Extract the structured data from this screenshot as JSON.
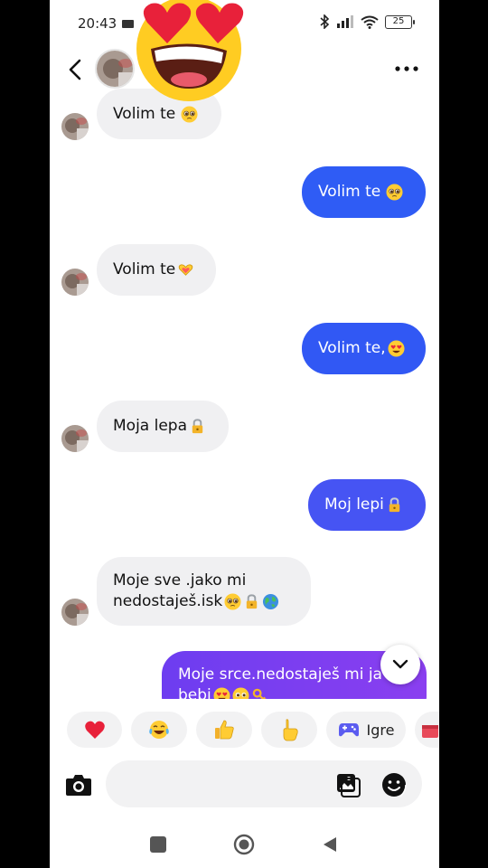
{
  "status_bar": {
    "time": "20:43",
    "battery": "25"
  },
  "composer": {
    "placeholder": ""
  },
  "messages": [
    {
      "direction": "in",
      "text": "Volim te",
      "emoji": [
        "pleading-face"
      ]
    },
    {
      "direction": "out",
      "text": "Volim te",
      "emoji": [
        "pleading-face"
      ]
    },
    {
      "direction": "in",
      "text": "Volim te",
      "emoji": [
        "heart-hands"
      ]
    },
    {
      "direction": "out",
      "text": "Volim te,",
      "emoji": [
        "heart-eyes-face"
      ]
    },
    {
      "direction": "in",
      "text": "Moja lepa",
      "emoji": [
        "lock"
      ]
    },
    {
      "direction": "out",
      "text": "Moj lepi",
      "emoji": [
        "lock"
      ]
    },
    {
      "direction": "in",
      "line1": "Moje sve .jako mi",
      "line2": "nedostaješ.isk",
      "emoji": [
        "pleading-face",
        "lock",
        "globe"
      ]
    },
    {
      "direction": "out",
      "line1": "Moje srce.nedostaješ mi ja",
      "line2": "bebi",
      "emoji": [
        "heart-eyes-face",
        "pleading-face",
        "key"
      ]
    }
  ],
  "quick_reactions": {
    "items": [
      "red-heart",
      "tears-of-joy",
      "thumbs-up",
      "pointing-up-hand"
    ],
    "games_label": "Igre"
  },
  "colors": {
    "outgoing_blue": "#2f5cf5",
    "outgoing_purple": "#7a3cf2",
    "incoming_bubble": "#f0f0f2"
  }
}
